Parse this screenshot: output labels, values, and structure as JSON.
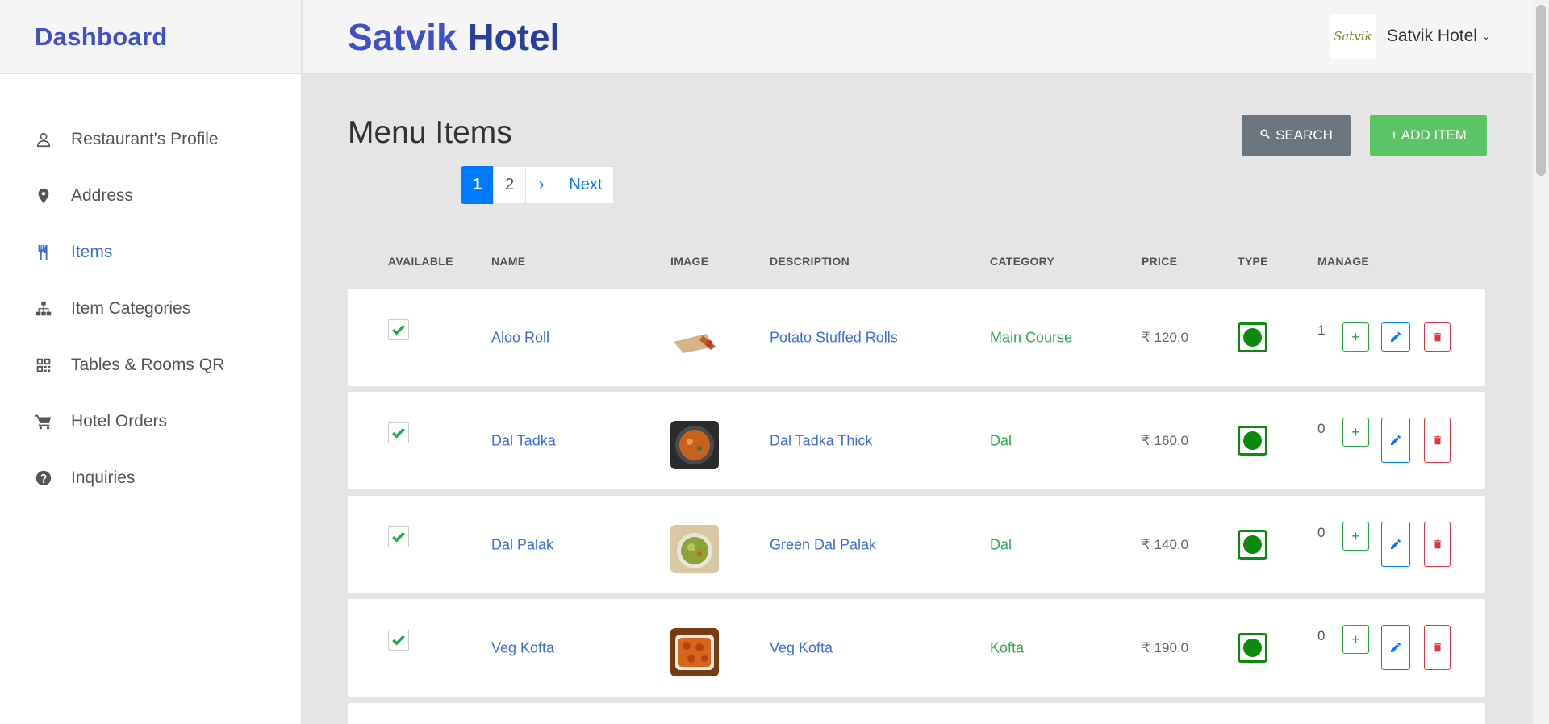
{
  "sidebar": {
    "brand": "Dashboard",
    "items": [
      {
        "label": "Restaurant's Profile",
        "icon": "user-icon",
        "active": false
      },
      {
        "label": "Address",
        "icon": "map-pin-icon",
        "active": false
      },
      {
        "label": "Items",
        "icon": "utensils-icon",
        "active": true
      },
      {
        "label": "Item Categories",
        "icon": "sitemap-icon",
        "active": false
      },
      {
        "label": "Tables & Rooms QR",
        "icon": "qr-code-icon",
        "active": false
      },
      {
        "label": "Hotel Orders",
        "icon": "cart-icon",
        "active": false
      },
      {
        "label": "Inquiries",
        "icon": "question-circle-icon",
        "active": false
      }
    ]
  },
  "topbar": {
    "title_part1": "Satvik",
    "title_part2": "Hotel",
    "logo_text": "Satvik",
    "user_name": "Satvik Hotel",
    "caret": "⌄"
  },
  "main": {
    "heading": "Menu Items",
    "search_label": "SEARCH",
    "add_label": "+ ADD ITEM",
    "pagination": {
      "current": "1",
      "page2": "2",
      "next_arrow": "›",
      "next_label": "Next"
    },
    "columns": [
      "AVAILABLE",
      "NAME",
      "IMAGE",
      "DESCRIPTION",
      "CATEGORY",
      "PRICE",
      "TYPE",
      "MANAGE"
    ],
    "rows": [
      {
        "available": true,
        "name": "Aloo Roll",
        "image": "aloo-roll-photo",
        "description": "Potato Stuffed Rolls",
        "category": "Main Course",
        "price": "₹ 120.0",
        "type": "veg",
        "qty": "1"
      },
      {
        "available": true,
        "name": "Dal Tadka",
        "image": "dal-tadka-photo",
        "description": "Dal Tadka Thick",
        "category": "Dal",
        "price": "₹ 160.0",
        "type": "veg",
        "qty": "0"
      },
      {
        "available": true,
        "name": "Dal Palak",
        "image": "dal-palak-photo",
        "description": "Green Dal Palak",
        "category": "Dal",
        "price": "₹ 140.0",
        "type": "veg",
        "qty": "0"
      },
      {
        "available": true,
        "name": "Veg Kofta",
        "image": "veg-kofta-photo",
        "description": "Veg Kofta",
        "category": "Kofta",
        "price": "₹ 190.0",
        "type": "veg",
        "qty": "0"
      }
    ]
  },
  "colors": {
    "accent": "#3f51c5",
    "link": "#3d6fd6",
    "veg": "#0b8a0b",
    "add": "#5cc465",
    "search": "#6c757d"
  }
}
